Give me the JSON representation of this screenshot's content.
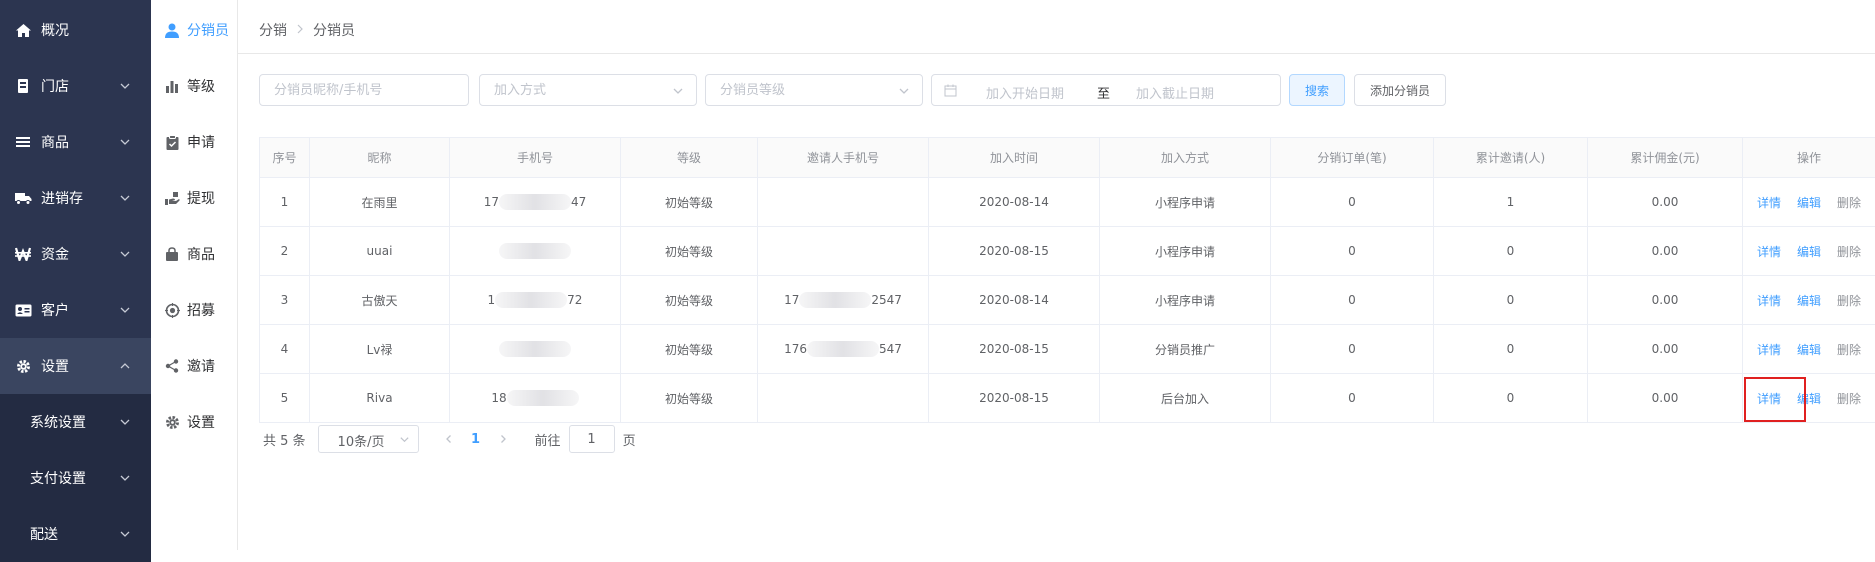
{
  "sidebar": {
    "items": [
      {
        "label": "概况",
        "icon": "home-icon"
      },
      {
        "label": "门店",
        "icon": "store-icon"
      },
      {
        "label": "商品",
        "icon": "list-icon"
      },
      {
        "label": "进销存",
        "icon": "truck-icon"
      },
      {
        "label": "资金",
        "icon": "won-icon"
      },
      {
        "label": "客户",
        "icon": "id-card-icon"
      },
      {
        "label": "设置",
        "icon": "gear-icon"
      }
    ],
    "sub_items": [
      {
        "label": "系统设置"
      },
      {
        "label": "支付设置"
      },
      {
        "label": "配送"
      }
    ]
  },
  "subnav": {
    "items": [
      {
        "label": "分销员",
        "icon": "user-icon"
      },
      {
        "label": "等级",
        "icon": "bar-chart-icon"
      },
      {
        "label": "申请",
        "icon": "clipboard-icon"
      },
      {
        "label": "提现",
        "icon": "hand-icon"
      },
      {
        "label": "商品",
        "icon": "bag-icon"
      },
      {
        "label": "招募",
        "icon": "target-icon"
      },
      {
        "label": "邀请",
        "icon": "share-icon"
      },
      {
        "label": "设置",
        "icon": "gear-icon"
      }
    ]
  },
  "breadcrumb": {
    "parent": "分销",
    "current": "分销员"
  },
  "filters": {
    "keyword_placeholder": "分销员昵称/手机号",
    "join_method_placeholder": "加入方式",
    "level_placeholder": "分销员等级",
    "start_date_placeholder": "加入开始日期",
    "range_separator": "至",
    "end_date_placeholder": "加入截止日期",
    "search_label": "搜索",
    "add_label": "添加分销员"
  },
  "table": {
    "headers": [
      "序号",
      "昵称",
      "手机号",
      "等级",
      "邀请人手机号",
      "加入时间",
      "加入方式",
      "分销订单(笔)",
      "累计邀请(人)",
      "累计佣金(元)",
      "操作"
    ],
    "rows": [
      {
        "index": "1",
        "nickname": "在雨里",
        "phone_pre": "17",
        "phone_post": "47",
        "level": "初始等级",
        "inviter_pre": "",
        "inviter_post": "",
        "join_time": "2020-08-14",
        "join_method": "小程序申请",
        "orders": "0",
        "invites": "1",
        "commission": "0.00"
      },
      {
        "index": "2",
        "nickname": "uuai",
        "phone_pre": "",
        "phone_post": "",
        "level": "初始等级",
        "inviter_pre": "",
        "inviter_post": "",
        "join_time": "2020-08-15",
        "join_method": "小程序申请",
        "orders": "0",
        "invites": "0",
        "commission": "0.00"
      },
      {
        "index": "3",
        "nickname": "古傲天",
        "phone_pre": "1",
        "phone_post": "72",
        "level": "初始等级",
        "inviter_pre": "17",
        "inviter_post": "2547",
        "join_time": "2020-08-14",
        "join_method": "小程序申请",
        "orders": "0",
        "invites": "0",
        "commission": "0.00"
      },
      {
        "index": "4",
        "nickname": "Lv禄",
        "phone_pre": "",
        "phone_post": "",
        "level": "初始等级",
        "inviter_pre": "176",
        "inviter_post": "547",
        "join_time": "2020-08-15",
        "join_method": "分销员推广",
        "orders": "0",
        "invites": "0",
        "commission": "0.00"
      },
      {
        "index": "5",
        "nickname": "Riva",
        "phone_pre": "18",
        "phone_post": "",
        "level": "初始等级",
        "inviter_pre": "",
        "inviter_post": "",
        "join_time": "2020-08-15",
        "join_method": "后台加入",
        "orders": "0",
        "invites": "0",
        "commission": "0.00"
      }
    ],
    "actions": {
      "detail": "详情",
      "edit": "编辑",
      "delete": "删除"
    }
  },
  "pagination": {
    "total_text": "共 5 条",
    "page_size": "10条/页",
    "current_page": "1",
    "goto_prefix": "前往",
    "goto_value": "1",
    "goto_suffix": "页"
  },
  "colors": {
    "sidebar_bg": "#2c3550",
    "accent": "#409eff",
    "highlight": "#e02020"
  }
}
